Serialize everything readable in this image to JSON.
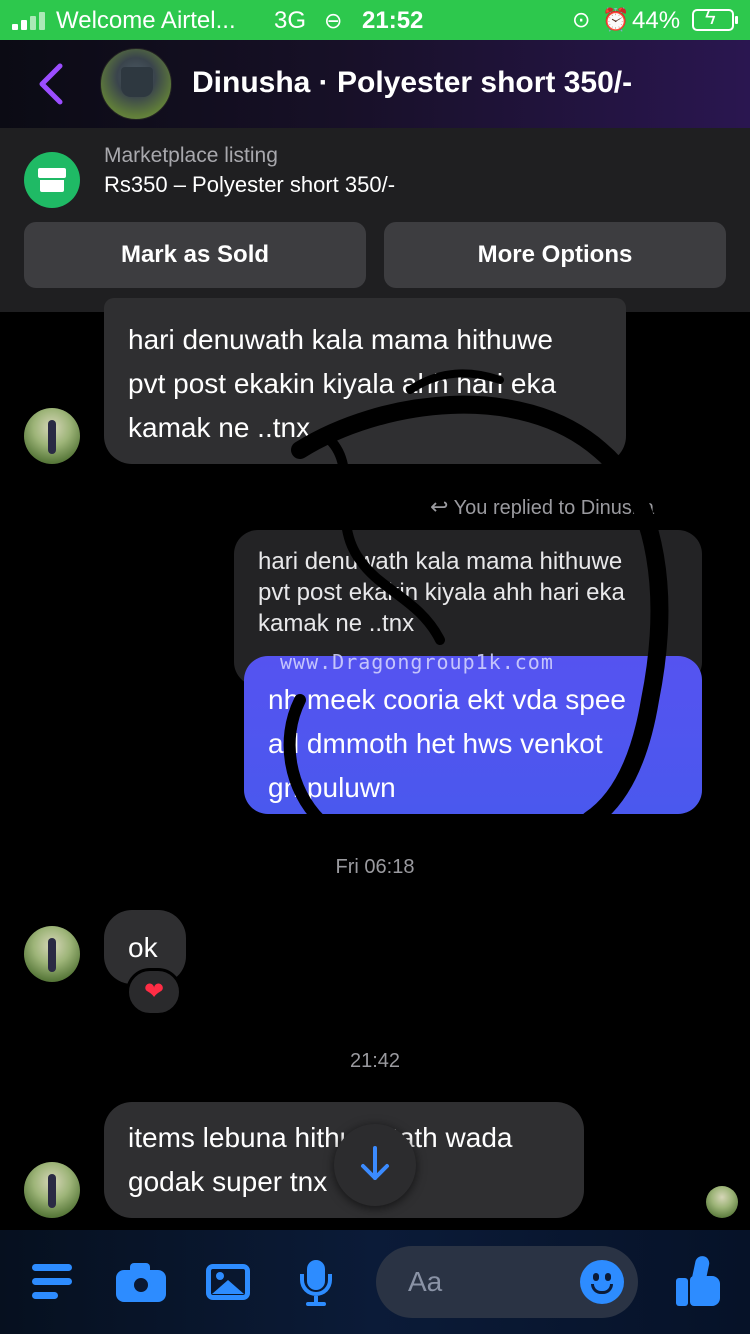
{
  "status_bar": {
    "carrier": "Welcome Airtel...",
    "network": "3G",
    "time": "21:52",
    "battery": "44%",
    "icons": [
      "signal-icon",
      "link-icon",
      "orientation-lock-icon",
      "alarm-icon",
      "battery-charging-icon"
    ]
  },
  "header": {
    "title": "Dinusha · Polyester short 350/-",
    "back_icon": "chevron-left-icon",
    "accent_color": "#9b4dff"
  },
  "marketplace": {
    "label": "Marketplace listing",
    "item": "Rs350 – Polyester short 350/-",
    "mark_sold": "Mark as Sold",
    "more_options": "More Options",
    "icon": "storefront-icon",
    "icon_color": "#1fba65"
  },
  "messages": {
    "incoming_1": {
      "line1": "hari denuwath kala mama hithuwe",
      "line2": "pvt post ekakin kiyala ahh hari eka",
      "line3": "kamak ne ..tnx"
    },
    "reply_label": "You replied to Dinusha",
    "reply_quote": {
      "line1": "hari denuwath kala mama hithuwe",
      "line2": "pvt post ekakin kiyala ahh hari eka",
      "line3": "kamak ne ..tnx"
    },
    "outgoing_1": {
      "line1": "nh meek cooria ekt vda spee",
      "line2": "ad dmmoth het hws venkot",
      "line3": "gn puluwn"
    },
    "watermark": "www.Dragongroup1k.com",
    "timestamp_1": "Fri 06:18",
    "incoming_2": "ok",
    "reaction": "❤",
    "timestamp_2": "21:42",
    "incoming_3": {
      "line1": "items lebuna hithuwatath wada",
      "line2": "godak super tnx"
    }
  },
  "composer": {
    "placeholder": "Aa",
    "accent_color": "#2d8cff",
    "icons": [
      "menu-icon",
      "camera-icon",
      "gallery-icon",
      "microphone-icon",
      "emoji-icon",
      "thumbs-up-icon"
    ]
  }
}
